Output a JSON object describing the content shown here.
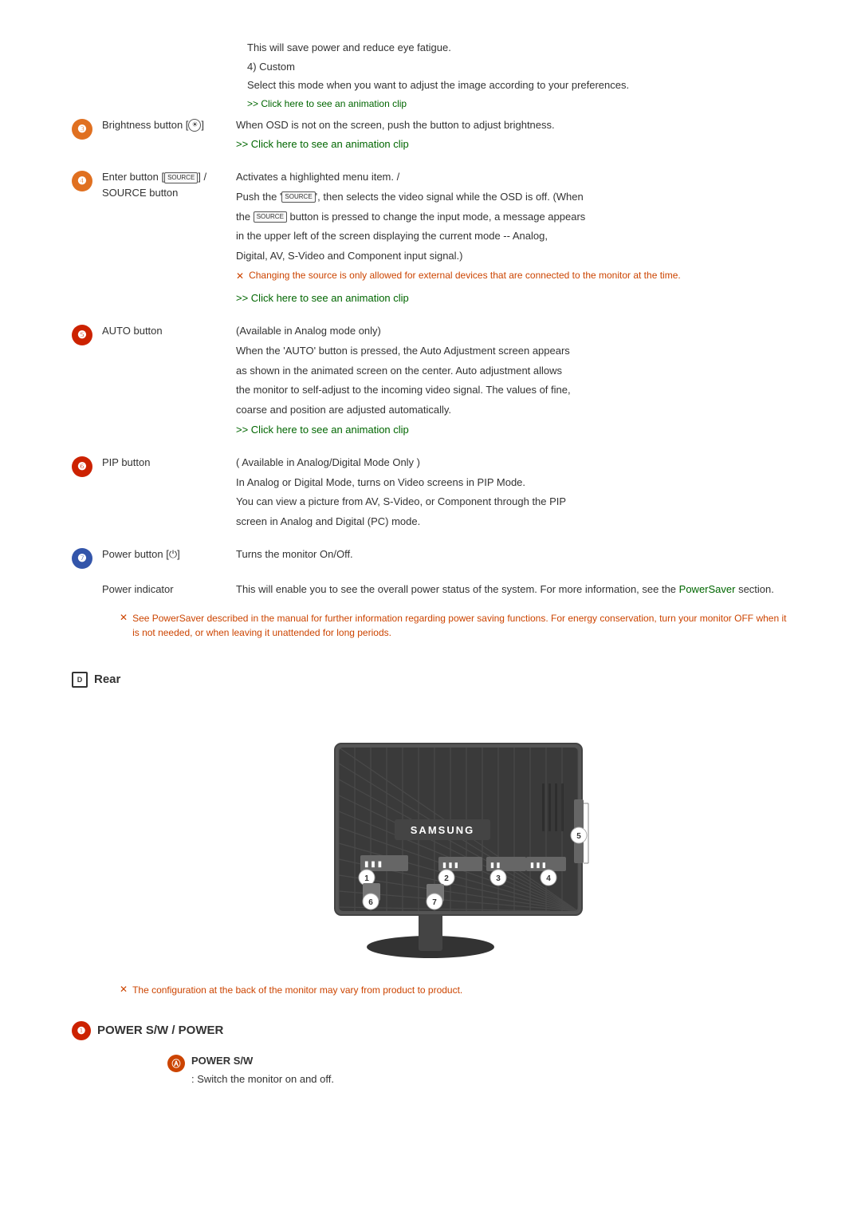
{
  "top": {
    "line1": "This will save power and reduce eye fatigue.",
    "custom_heading": "4) Custom",
    "custom_desc": "Select this mode when you want to adjust the image according to your preferences.",
    "custom_link": ">> Click here to see an animation clip"
  },
  "buttons": [
    {
      "id": "3",
      "number": "❸",
      "color": "orange",
      "label": "Brightness button [☀]",
      "desc_lines": [
        "When OSD is not on the screen, push the button to adjust brightness.",
        ">> Click here to see an animation clip"
      ],
      "link_index": 1
    },
    {
      "id": "4",
      "number": "❹",
      "color": "orange",
      "label_lines": [
        "Enter button [SOURCE] /",
        "SOURCE button"
      ],
      "desc_lines": [
        "Activates a highlighted menu item. /",
        "Push the 'SOURCE', then selects the video signal while the OSD is off. (When",
        "the SOURCE button is pressed to change the input mode, a message appears",
        "in the upper left of the screen displaying the current mode -- Analog,",
        "Digital, AV, S-Video and Component input signal.)"
      ],
      "note": "Changing the source is only allowed for external devices that are connected to the monitor at the time.",
      "link": ">> Click here to see an animation clip"
    },
    {
      "id": "5",
      "number": "❺",
      "color": "red",
      "label": "AUTO button",
      "desc_lines": [
        "(Available in Analog mode only)",
        "When the 'AUTO' button is pressed, the Auto Adjustment screen appears",
        "as shown in the animated screen on the center. Auto adjustment allows",
        "the monitor to self-adjust to the incoming video signal. The values of fine,",
        "coarse and position are adjusted automatically.",
        ">> Click here to see an animation clip"
      ],
      "link_index": 5
    },
    {
      "id": "6",
      "number": "❻",
      "color": "red",
      "label": "PIP button",
      "desc_lines": [
        "( Available in Analog/Digital Mode Only )",
        "In Analog or Digital Mode, turns on Video screens in PIP Mode.",
        "You can view a picture from AV, S-Video, or Component through the PIP",
        "screen in Analog and Digital (PC) mode."
      ]
    },
    {
      "id": "7",
      "number": "❼",
      "color": "blue",
      "label": "Power button [⏻]",
      "desc": "Turns the monitor On/Off."
    },
    {
      "id": "pi",
      "label": "Power indicator",
      "desc_part1": "This will enable you to see the overall power status of the system. For more information, see the ",
      "desc_link": "PowerSaver",
      "desc_part2": " section."
    }
  ],
  "power_note": "See PowerSaver described in the manual for further information regarding power saving functions. For energy conservation, turn your monitor OFF when it is not needed, or when leaving it unattended for long periods.",
  "rear": {
    "heading": "Rear",
    "note": "The configuration at the back of the monitor may vary from product to product."
  },
  "power_section": {
    "heading": "POWER S/W / POWER",
    "sub_heading": "POWER S/W",
    "sub_desc": ": Switch the monitor on and off."
  }
}
